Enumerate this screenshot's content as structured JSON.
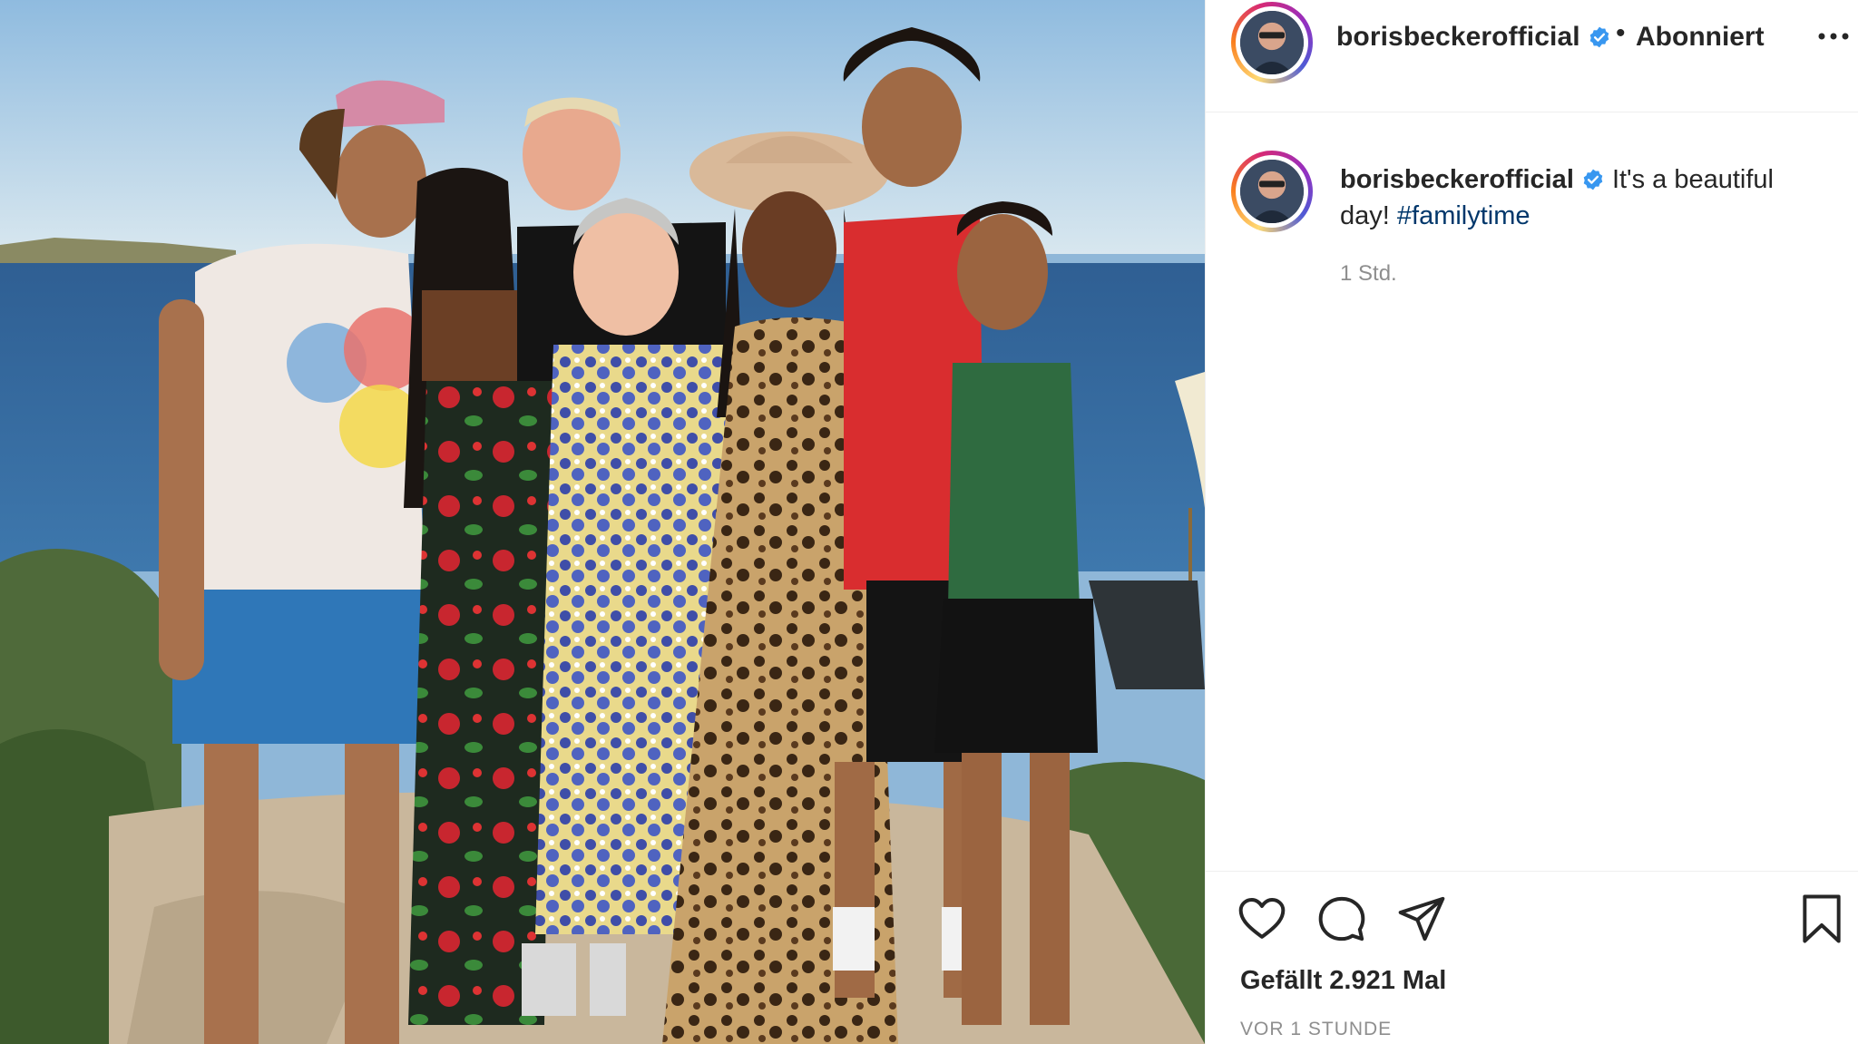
{
  "post": {
    "username": "borisbeckerofficial",
    "separator": "•",
    "follow_status": "Abonniert",
    "caption": {
      "username": "borisbeckerofficial",
      "text": "It's a beautiful day!",
      "hashtag": "#familytime",
      "relative_time": "1 Std."
    },
    "likes_label": "Gefällt 2.921 Mal",
    "timestamp": "VOR 1 STUNDE"
  },
  "icons": {
    "verified": "verified-badge-icon",
    "more": "more-options-icon",
    "like": "heart-icon",
    "comment": "comment-icon",
    "share": "paper-plane-icon",
    "save": "bookmark-icon"
  },
  "colors": {
    "verified_blue": "#3897f0",
    "hashtag": "#00376b",
    "muted_text": "#8e8e8e",
    "primary_text": "#262626"
  }
}
